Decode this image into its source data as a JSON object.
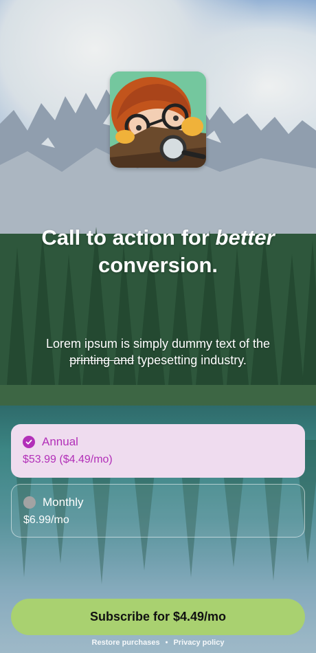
{
  "app_icon": {
    "name": "app-icon-kid-with-magnifier"
  },
  "headline": {
    "line1_prefix": "Call to action for ",
    "line1_em": "better",
    "line2": "conversion."
  },
  "subtext": {
    "part1": "Lorem ipsum is simply dummy text of the",
    "strikethrough": "printing and",
    "part2": " typesetting industry."
  },
  "plans": [
    {
      "name": "Annual",
      "price": "$53.99 ($4.49/mo)",
      "selected": true
    },
    {
      "name": "Monthly",
      "price": "$6.99/mo",
      "selected": false
    }
  ],
  "cta": {
    "label": "Subscribe for $4.49/mo"
  },
  "footer": {
    "restore": "Restore purchases",
    "separator": "•",
    "privacy": "Privacy policy"
  },
  "colors": {
    "accent": "#b22fb8",
    "selected_bg": "#efdcef",
    "cta_bg": "#a9d170"
  }
}
